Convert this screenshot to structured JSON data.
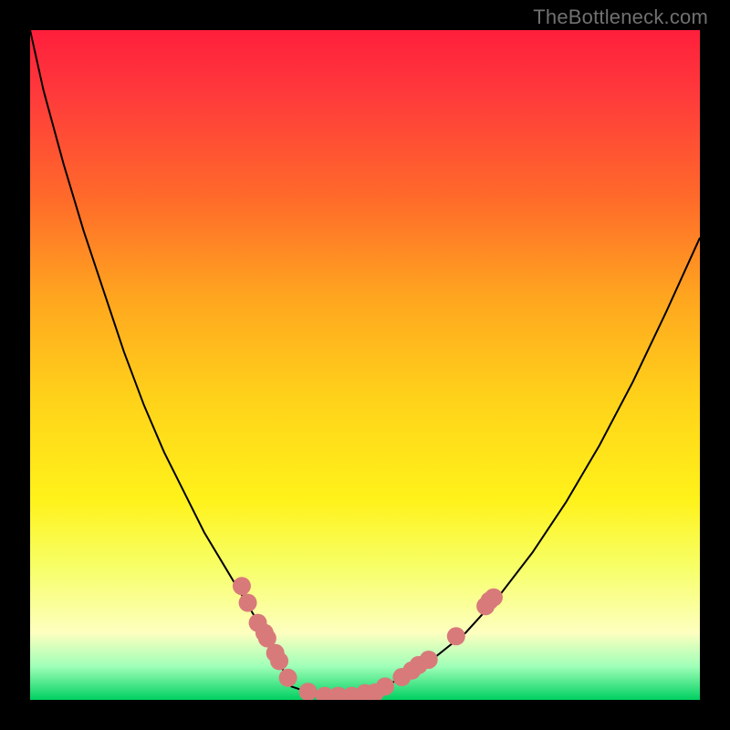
{
  "watermark": "TheBottleneck.com",
  "chart_data": {
    "type": "line",
    "title": "",
    "xlabel": "",
    "ylabel": "",
    "xlim": [
      0,
      100
    ],
    "ylim": [
      0,
      100
    ],
    "grid": false,
    "legend": false,
    "series": [
      {
        "name": "curve",
        "x": [
          0,
          2,
          5,
          8,
          11,
          14,
          17,
          20,
          23,
          26,
          29,
          32,
          35,
          36,
          37,
          38,
          39,
          42,
          45,
          48,
          51,
          55,
          60,
          65,
          70,
          75,
          80,
          85,
          90,
          95,
          100
        ],
        "y": [
          100,
          91,
          80,
          70,
          61,
          52,
          44,
          37,
          31,
          25,
          20,
          15,
          10,
          8,
          6,
          4,
          2,
          1,
          0.6,
          0.6,
          1.3,
          3,
          6,
          10,
          15.5,
          22,
          29.5,
          38,
          47.5,
          58,
          69
        ],
        "stroke": "#000000",
        "stroke_width": 2
      }
    ],
    "markers": [
      {
        "name": "scatter-points",
        "color": "#d87a7a",
        "radius": 10,
        "points": [
          {
            "x": 31.6,
            "y": 17.0
          },
          {
            "x": 32.5,
            "y": 14.5
          },
          {
            "x": 34.0,
            "y": 11.5
          },
          {
            "x": 35.0,
            "y": 10.0
          },
          {
            "x": 35.4,
            "y": 9.2
          },
          {
            "x": 36.6,
            "y": 7.0
          },
          {
            "x": 37.2,
            "y": 5.8
          },
          {
            "x": 38.5,
            "y": 3.3
          },
          {
            "x": 41.5,
            "y": 1.2
          },
          {
            "x": 44.0,
            "y": 0.6
          },
          {
            "x": 46.0,
            "y": 0.6
          },
          {
            "x": 48.0,
            "y": 0.6
          },
          {
            "x": 50.0,
            "y": 1.0
          },
          {
            "x": 51.5,
            "y": 1.1
          },
          {
            "x": 53.0,
            "y": 2.0
          },
          {
            "x": 55.5,
            "y": 3.4
          },
          {
            "x": 57.0,
            "y": 4.4
          },
          {
            "x": 58.0,
            "y": 5.2
          },
          {
            "x": 59.5,
            "y": 6.0
          },
          {
            "x": 63.6,
            "y": 9.5
          },
          {
            "x": 68.0,
            "y": 14.0
          },
          {
            "x": 68.6,
            "y": 14.8
          },
          {
            "x": 69.2,
            "y": 15.3
          }
        ]
      }
    ]
  }
}
